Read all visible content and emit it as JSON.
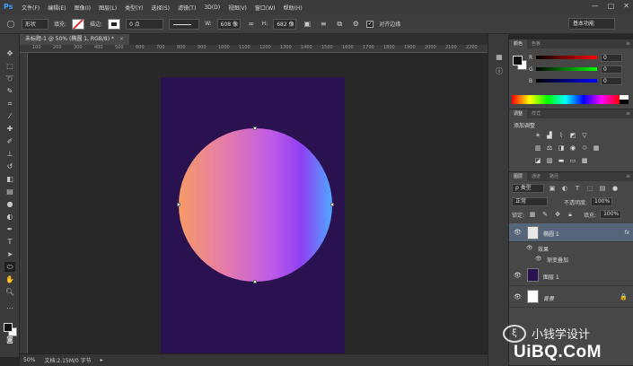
{
  "app": {
    "logo": "Ps"
  },
  "menu": [
    "文件(F)",
    "编辑(E)",
    "图像(I)",
    "图层(L)",
    "类型(Y)",
    "选择(S)",
    "滤镜(T)",
    "3D(D)",
    "视图(V)",
    "窗口(W)",
    "帮助(H)"
  ],
  "window_controls": {
    "minimize": "—",
    "maximize": "□",
    "close": "✕"
  },
  "options": {
    "mode": "形状",
    "fill_label": "填充:",
    "stroke_label": "描边:",
    "stroke_width": "0 点",
    "w_label": "W:",
    "w_value": "608 像",
    "h_label": "H:",
    "h_value": "682 像",
    "align_edges_label": "对齐边缘",
    "workspace": "基本功能"
  },
  "document": {
    "tab_title": "未标题-1 @ 50% (椭圆 1, RGB/8) *",
    "close": "×"
  },
  "ruler_h": [
    "100",
    "200",
    "300",
    "400",
    "500",
    "600",
    "700",
    "800",
    "900",
    "1000",
    "1100",
    "1200",
    "1300",
    "1400",
    "1500",
    "1600",
    "1700",
    "1800",
    "1900",
    "2000",
    "2100",
    "2200"
  ],
  "status": {
    "zoom": "50%",
    "doc_info": "文档:2.15M/0 字节",
    "arrow": "▸"
  },
  "color_panel": {
    "tabs": [
      "颜色",
      "色板"
    ],
    "r_label": "R",
    "r_value": "0",
    "g_label": "G",
    "g_value": "0",
    "b_label": "B",
    "b_value": "0",
    "menu": "≡"
  },
  "adjustments_panel": {
    "tabs": [
      "调整",
      "样式"
    ],
    "title": "添加调整",
    "menu": "≡"
  },
  "layers_panel": {
    "tabs": [
      "图层",
      "通道",
      "路径"
    ],
    "menu": "≡",
    "filter_kind": "ρ 类型",
    "blend_mode": "正常",
    "opacity_label": "不透明度:",
    "opacity_value": "100%",
    "lock_label": "锁定:",
    "fill_label": "填充:",
    "fill_value": "100%",
    "layers": [
      {
        "name": "椭圆 1",
        "fx": "fx",
        "selected": true,
        "thumb_color": "#e8e8e8"
      },
      {
        "name": "图层 1",
        "selected": false,
        "thumb_color": "#2a1250"
      },
      {
        "name": "背景",
        "selected": false,
        "thumb_color": "#ffffff",
        "locked": true
      }
    ],
    "effects_label": "效果",
    "effect_item": "渐变叠加",
    "lock_icon": "🔒"
  },
  "colors": {
    "artboard": "#2a1250",
    "gradient": [
      "#f59a66",
      "#c05ce6",
      "#4fa8ff"
    ],
    "selected_layer": "#56657a"
  },
  "watermark": {
    "logo": "ξ",
    "line1": "小钱学设计",
    "line2": "UiBQ.CoM"
  }
}
